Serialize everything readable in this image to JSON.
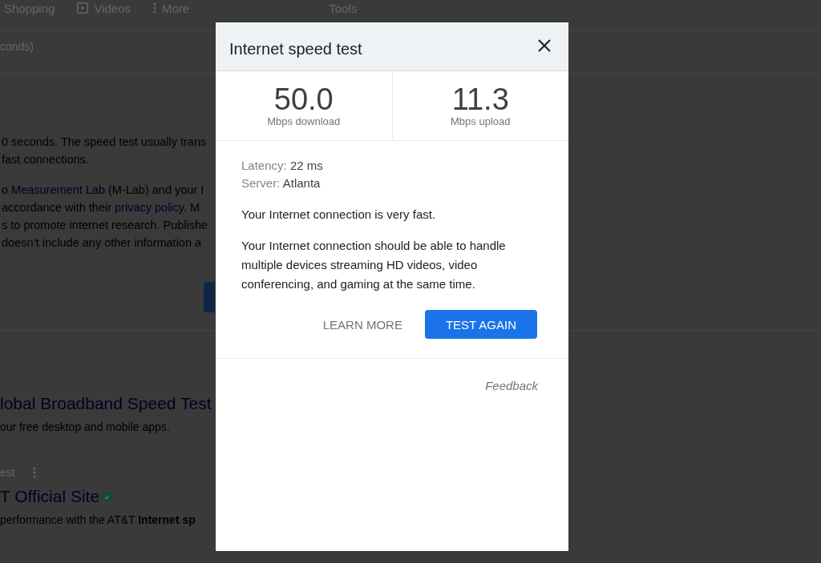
{
  "search_tabs": [
    {
      "label": "Shopping",
      "kind": "plain"
    },
    {
      "label": "Videos",
      "kind": "video"
    },
    {
      "label": "More",
      "kind": "more"
    }
  ],
  "tools": "Tools",
  "stats_line": "conds)",
  "info_paragraphs": [
    {
      "lines": [
        [
          {
            "kind": "text",
            "text": "0 seconds. The speed test usually trans"
          }
        ],
        [
          {
            "kind": "text",
            "text": "fast connections."
          }
        ]
      ]
    },
    {
      "lines": [
        [
          {
            "kind": "text",
            "text": "o "
          },
          {
            "kind": "link",
            "text": "Measurement Lab"
          },
          {
            "kind": "text",
            "text": " (M-Lab) and your I"
          }
        ],
        [
          {
            "kind": "text",
            "text": "accordance with their "
          },
          {
            "kind": "link",
            "text": "privacy policy"
          },
          {
            "kind": "text",
            "text": ". M"
          }
        ],
        [
          {
            "kind": "text",
            "text": "s to promote internet research. Publishe"
          }
        ],
        [
          {
            "kind": "text",
            "text": "doesn’t include any other information a"
          }
        ]
      ]
    }
  ],
  "results": [
    {
      "title": "lobal Broadband Speed Test",
      "snippet": "our free desktop and mobile apps."
    },
    {
      "source": "est",
      "title": "T Official Site",
      "verified": true,
      "snippet": "performance with the AT&T **Internet sp**"
    }
  ],
  "dialog": {
    "title": "Internet speed test",
    "metrics": [
      {
        "value": "50.0",
        "unit": "Mbps download"
      },
      {
        "value": "11.3",
        "unit": "Mbps upload"
      }
    ],
    "details": [
      {
        "label": "Latency:",
        "value": "22 ms"
      },
      {
        "label": "Server:",
        "value": "Atlanta"
      }
    ],
    "summary": "Your Internet connection is very fast.",
    "description": "Your Internet connection should be able to handle multiple devices streaming HD videos, video conferencing, and gaming at the same time.",
    "buttons": [
      {
        "label": "LEARN MORE",
        "kind": "text"
      },
      {
        "label": "TEST AGAIN",
        "kind": "primary"
      }
    ],
    "feedback": "Feedback"
  }
}
